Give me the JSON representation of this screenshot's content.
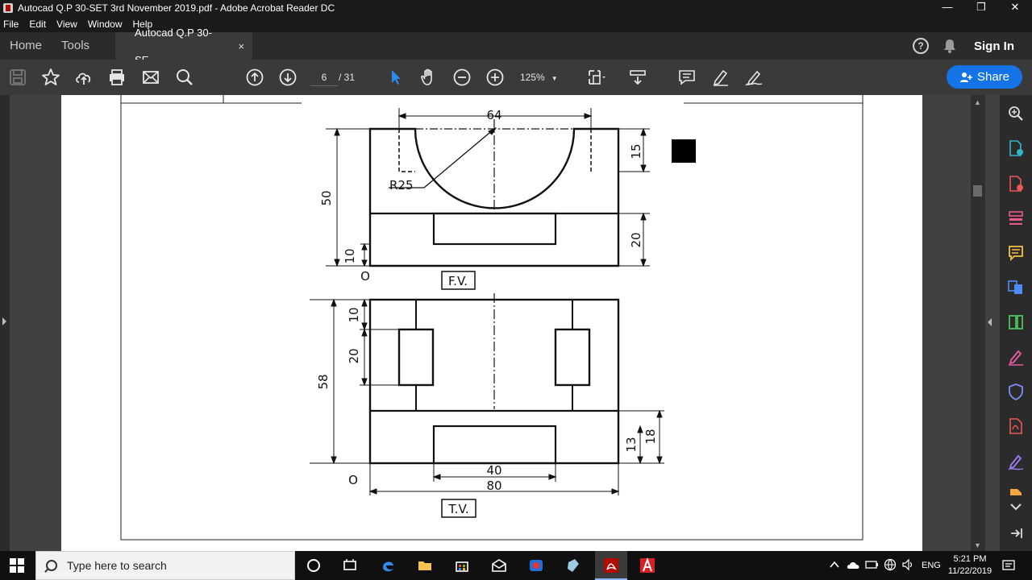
{
  "window": {
    "title": "Autocad Q.P 30-SET 3rd November 2019.pdf - Adobe Acrobat Reader DC",
    "min": "—",
    "max": "❐",
    "close": "✕"
  },
  "menu": {
    "items": [
      "File",
      "Edit",
      "View",
      "Window",
      "Help"
    ]
  },
  "tabs": {
    "home": "Home",
    "tools": "Tools",
    "doc": "Autocad Q.P 30-SE...",
    "close": "×",
    "signin": "Sign In",
    "help": "?"
  },
  "toolbar": {
    "page_current": "6",
    "page_total": "/  31",
    "zoom": "125%",
    "share": "Share"
  },
  "drawing": {
    "fv": {
      "dim_width": "64",
      "dim_radius": "R25",
      "dim_height": "50",
      "dim_top": "15",
      "dim_right": "20",
      "dim_base": "10",
      "label": "F.V.",
      "origin": "O"
    },
    "tv": {
      "dim_depth": "58",
      "dim_a": "10",
      "dim_b": "20",
      "dim_c": "13",
      "dim_d": "18",
      "dim_inner": "40",
      "dim_overall": "80",
      "label": "T.V.",
      "origin": "O"
    }
  },
  "taskbar": {
    "search_placeholder": "Type here to search",
    "lang": "ENG",
    "time": "5:21 PM",
    "date": "11/22/2019"
  },
  "colors": {
    "accent": "#1473e6",
    "toolbar": "#3a3a3a",
    "tabbar": "#2b2b2b",
    "acrobat": "#b30b00"
  }
}
